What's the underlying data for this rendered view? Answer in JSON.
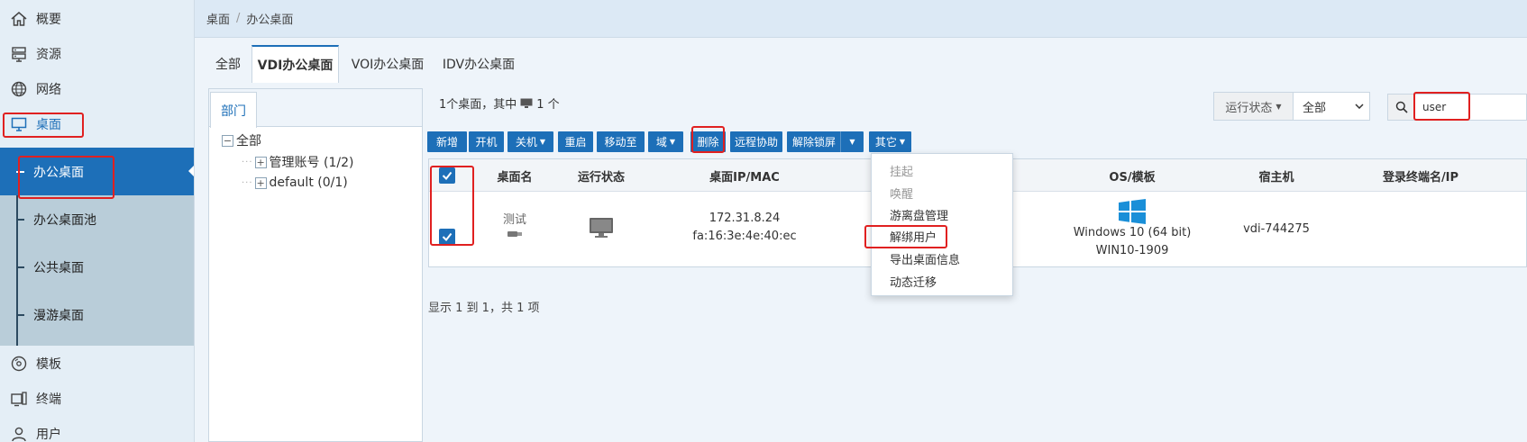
{
  "sidebar": {
    "items": [
      {
        "label": "概要",
        "icon": "home-icon"
      },
      {
        "label": "资源",
        "icon": "server-icon"
      },
      {
        "label": "网络",
        "icon": "globe-icon"
      },
      {
        "label": "桌面",
        "icon": "monitor-icon"
      },
      {
        "label": "模板",
        "icon": "disc-icon"
      },
      {
        "label": "终端",
        "icon": "terminal-icon"
      },
      {
        "label": "用户",
        "icon": "user-icon"
      }
    ],
    "sub_items": [
      {
        "label": "办公桌面",
        "active": true
      },
      {
        "label": "办公桌面池"
      },
      {
        "label": "公共桌面"
      },
      {
        "label": "漫游桌面"
      }
    ]
  },
  "breadcrumb": {
    "root": "桌面",
    "separator": "/",
    "current": "办公桌面"
  },
  "tabs": [
    {
      "label": "全部"
    },
    {
      "label": "VDI办公桌面",
      "active": true
    },
    {
      "label": "VOI办公桌面"
    },
    {
      "label": "IDV办公桌面"
    }
  ],
  "department": {
    "tab_label": "部门",
    "tree": [
      {
        "label": "全部",
        "expander": "−"
      },
      {
        "label": "管理账号 (1/2)",
        "expander": "+"
      },
      {
        "label": "default (0/1)",
        "expander": "+"
      }
    ]
  },
  "summary": {
    "prefix": "1个桌面，其中",
    "count": "1 个"
  },
  "filter": {
    "label": "运行状态",
    "value": "全部"
  },
  "search": {
    "value": "user"
  },
  "toolbar": {
    "new": "新增",
    "power_on": "开机",
    "shutdown": "关机",
    "restart": "重启",
    "move_to": "移动至",
    "domain": "域",
    "delete": "删除",
    "remote_assist": "远程协助",
    "unlock_screen": "解除锁屏",
    "other": "其它"
  },
  "table": {
    "columns": [
      "桌面名",
      "运行状态",
      "桌面IP/MAC",
      "OS/模板",
      "宿主机",
      "登录终端名/IP"
    ],
    "rows": [
      {
        "name": "测试",
        "ip": "172.31.8.24",
        "mac": "fa:16:3e:4e:40:ec",
        "os": "Windows 10 (64 bit)",
        "template": "WIN10-1909",
        "host": "vdi-744275",
        "checked": true
      }
    ]
  },
  "footer": {
    "info": "显示 1 到 1，共 1 项"
  },
  "dropdown": {
    "items": [
      {
        "label": "挂起",
        "disabled": true
      },
      {
        "label": "唤醒",
        "disabled": true
      },
      {
        "label": "游离盘管理"
      },
      {
        "label": "解绑用户"
      },
      {
        "label": "导出桌面信息"
      },
      {
        "label": "动态迁移"
      }
    ]
  },
  "colors": {
    "accent": "#1d6fb8",
    "highlight": "#e02020",
    "sidebar_bg": "#e4eef6"
  }
}
